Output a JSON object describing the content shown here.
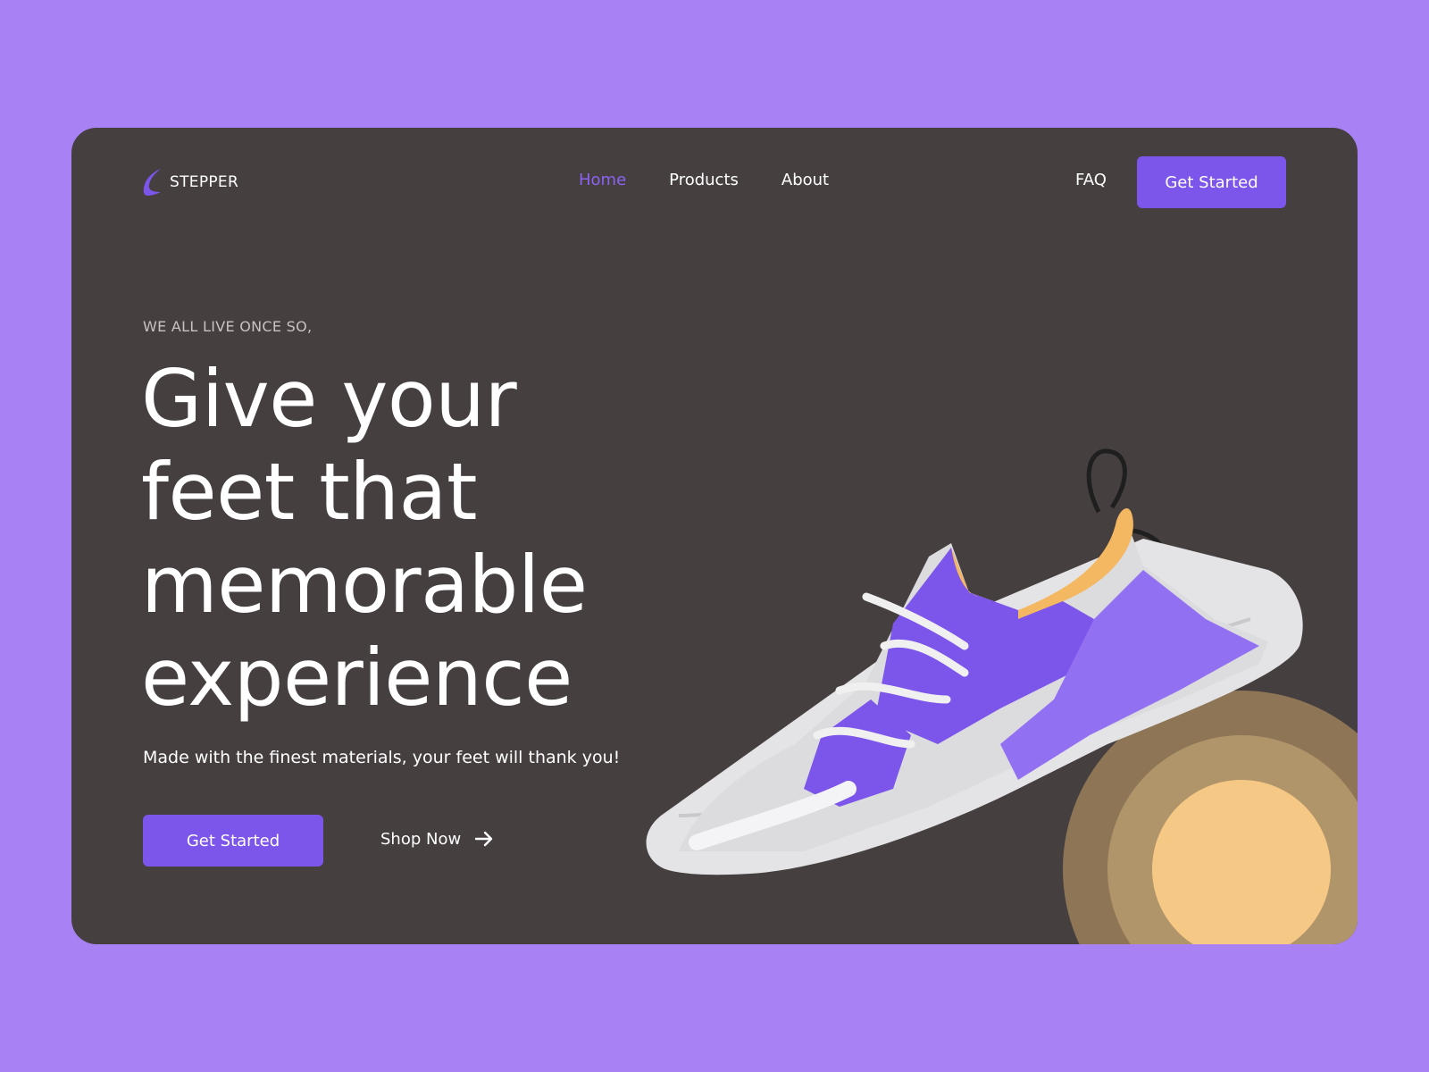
{
  "brand": {
    "name": "STEPPER",
    "logo_icon": "stepper-logo-icon"
  },
  "nav": {
    "items": [
      {
        "label": "Home",
        "active": true
      },
      {
        "label": "Products",
        "active": false
      },
      {
        "label": "About",
        "active": false
      }
    ],
    "faq_label": "FAQ",
    "cta_label": "Get Started"
  },
  "hero": {
    "eyebrow": "WE ALL LIVE ONCE SO,",
    "headline_lines": [
      "Give your",
      "feet that",
      "memorable",
      "experience"
    ],
    "subtitle": "Made with the finest materials, your feet will thank you!",
    "primary_cta": "Get Started",
    "secondary_cta": "Shop Now",
    "secondary_icon": "arrow-right-icon"
  },
  "colors": {
    "page_background": "#a882f5",
    "card_background": "#463f40",
    "accent": "#7c55ea",
    "active_nav": "#8b63f0",
    "circle_outer": "#8d7555",
    "circle_middle": "#b0946a",
    "circle_inner": "#f6c885"
  }
}
